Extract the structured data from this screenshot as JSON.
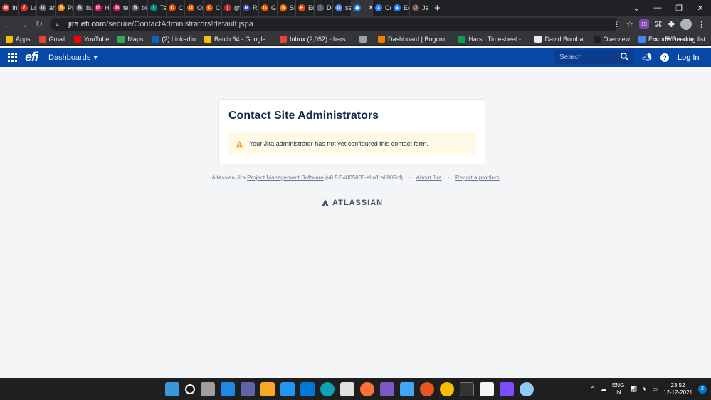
{
  "browser": {
    "tabs": [
      {
        "label": "Int",
        "color": "#ea4335",
        "glyph": "M"
      },
      {
        "label": "Lo",
        "color": "#d93025",
        "glyph": "/"
      },
      {
        "label": "ah",
        "color": "#5f6368",
        "glyph": "G"
      },
      {
        "label": "Pr",
        "color": "#f57c00",
        "glyph": "b"
      },
      {
        "label": "bu",
        "color": "#5f6368",
        "glyph": "b"
      },
      {
        "label": "Ho",
        "color": "#d81b60",
        "glyph": "ib"
      },
      {
        "label": "te",
        "color": "#d81b60",
        "glyph": "ib"
      },
      {
        "label": "bu",
        "color": "#5f6368",
        "glyph": "b"
      },
      {
        "label": "Te",
        "color": "#00897b",
        "glyph": "T"
      },
      {
        "label": "Cit",
        "color": "#e65100",
        "glyph": "C"
      },
      {
        "label": "On",
        "color": "#e65100",
        "glyph": "O"
      },
      {
        "label": "Co",
        "color": "#e65100",
        "glyph": "C"
      },
      {
        "label": "gh",
        "color": "#c62828",
        "glyph": "|"
      },
      {
        "label": "Re",
        "color": "#3949ab",
        "glyph": "R"
      },
      {
        "label": "G I",
        "color": "#e65100",
        "glyph": "G"
      },
      {
        "label": "Sh",
        "color": "#ef6c00",
        "glyph": "S"
      },
      {
        "label": "Ed",
        "color": "#e65100",
        "glyph": "E"
      },
      {
        "label": "Do",
        "color": "#5f6368",
        "glyph": "↓"
      },
      {
        "label": "se",
        "color": "#4285f4",
        "glyph": "G"
      },
      {
        "label": "",
        "color": "#2684ff",
        "glyph": "◆",
        "active": true
      },
      {
        "label": "Co",
        "color": "#2684ff",
        "glyph": "▲"
      },
      {
        "label": "Ed",
        "color": "#2684ff",
        "glyph": "▲"
      },
      {
        "label": "Jel",
        "color": "#795548",
        "glyph": "J"
      }
    ],
    "url_host": "jira.efi.com",
    "url_path": "/secure/ContactAdministrators!default.jspa",
    "extension_badge": "15",
    "bookmarks": [
      {
        "label": "Apps",
        "color": "#fbbc05"
      },
      {
        "label": "Gmail",
        "color": "#ea4335"
      },
      {
        "label": "YouTube",
        "color": "#ff0000"
      },
      {
        "label": "Maps",
        "color": "#34a853"
      },
      {
        "label": "(2) LinkedIn",
        "color": "#0a66c2"
      },
      {
        "label": "Batch 64 - Google...",
        "color": "#fbbc05"
      },
      {
        "label": "Inbox (2,052) - hars...",
        "color": "#ea4335"
      },
      {
        "label": "",
        "color": "#9aa0a6"
      },
      {
        "label": "Dashboard | Bugcro...",
        "color": "#f57c00"
      },
      {
        "label": "Harsh Timesheet -...",
        "color": "#0f9d58"
      },
      {
        "label": "David Bombal",
        "color": "#e8eaed"
      },
      {
        "label": "Overview",
        "color": "#202124"
      },
      {
        "label": "Encode/Decode",
        "color": "#4285f4"
      }
    ],
    "bookmarks_more": "»",
    "reading_list": "Reading list"
  },
  "jira": {
    "logo": "efi",
    "dashboards_label": "Dashboards",
    "search_placeholder": "Search",
    "login_label": "Log In"
  },
  "main": {
    "title": "Contact Site Administrators",
    "warning": "Your Jira administrator has not yet configured this contact form."
  },
  "footer": {
    "prefix": "Atlassian Jira",
    "link_pms": "Project Management Software",
    "version": "(v8.5.5#805005-sha1:a6982cf)",
    "about": "About Jira",
    "report": "Report a problem",
    "brand": "ATLASSIAN"
  },
  "taskbar": {
    "lang_line1": "ENG",
    "lang_line2": "IN",
    "time": "23:52",
    "date": "12-12-2021",
    "notifications": "2"
  },
  "colors": {
    "jira_header": "#0747a6",
    "warning_bg": "#fffae6",
    "warning_icon": "#ff991f"
  }
}
